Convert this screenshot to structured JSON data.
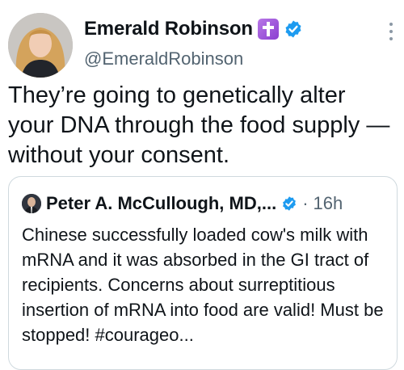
{
  "author": {
    "display_name": "Emerald Robinson",
    "handle": "@EmeraldRobinson",
    "avatar_icon": "profile-photo",
    "badge_icon": "latin-cross-emoji",
    "verified_icon": "blue-verified-badge"
  },
  "more_icon": "three-dots-vertical",
  "tweet": {
    "text": "They’re going to genetically alter your DNA through the food supply — without your consent."
  },
  "quoted": {
    "display_name": "Peter A. McCullough, MD,...",
    "separator": "·",
    "time": "16h",
    "text": "Chinese successfully loaded cow's milk with mRNA and it was absorbed in the GI tract of recipients.  Concerns about surreptitious insertion of mRNA into food are valid!  Must be stopped!  #courageo...",
    "avatar_icon": "profile-photo",
    "verified_icon": "blue-verified-badge"
  },
  "colors": {
    "text": "#0f1419",
    "secondary": "#536471",
    "verified": "#1d9bf0",
    "border": "#cfd9de",
    "badge_purple": "#9b51e0"
  }
}
